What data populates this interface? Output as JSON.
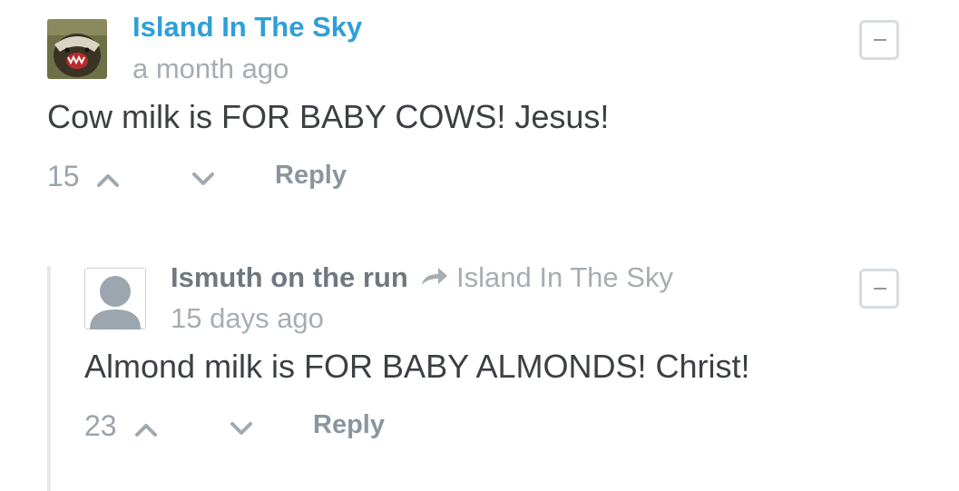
{
  "comments": [
    {
      "author": "Island In The Sky",
      "timestamp": "a month ago",
      "text": "Cow milk is FOR BABY COWS! Jesus!",
      "votes": "15",
      "reply_label": "Reply",
      "author_color": "#2e9fd8",
      "avatar_icon": "honey-badger-avatar"
    },
    {
      "author": "Ismuth on the run",
      "reply_to": "Island In The Sky",
      "timestamp": "15 days ago",
      "text": "Almond milk is FOR BABY ALMONDS! Christ!",
      "votes": "23",
      "reply_label": "Reply",
      "author_color": "#6f7880",
      "avatar_icon": "default-user-avatar"
    }
  ],
  "colors": {
    "muted": "#a6adb3",
    "body": "#3c3f43",
    "thread_line": "#e4e8eb"
  }
}
